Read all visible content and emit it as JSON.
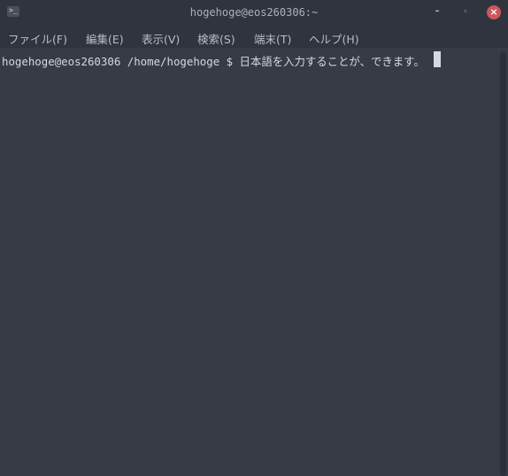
{
  "window": {
    "title": "hogehoge@eos260306:~",
    "icon": "terminal-icon",
    "buttons": {
      "minimize": "minimize-icon",
      "maximize": "maximize-icon",
      "close": "close-icon"
    }
  },
  "menu": {
    "file": "ファイル(F)",
    "edit": "編集(E)",
    "view": "表示(V)",
    "search": "検索(S)",
    "terminal": "端末(T)",
    "help": "ヘルプ(H)"
  },
  "terminal": {
    "prompt_line": "hogehoge@eos260306 /home/hogehoge $ 日本語を入力することが、できます。"
  },
  "colors": {
    "titlebar": "#2f343f",
    "background": "#363b46",
    "text": "#d3dae3",
    "close": "#cc575d"
  }
}
